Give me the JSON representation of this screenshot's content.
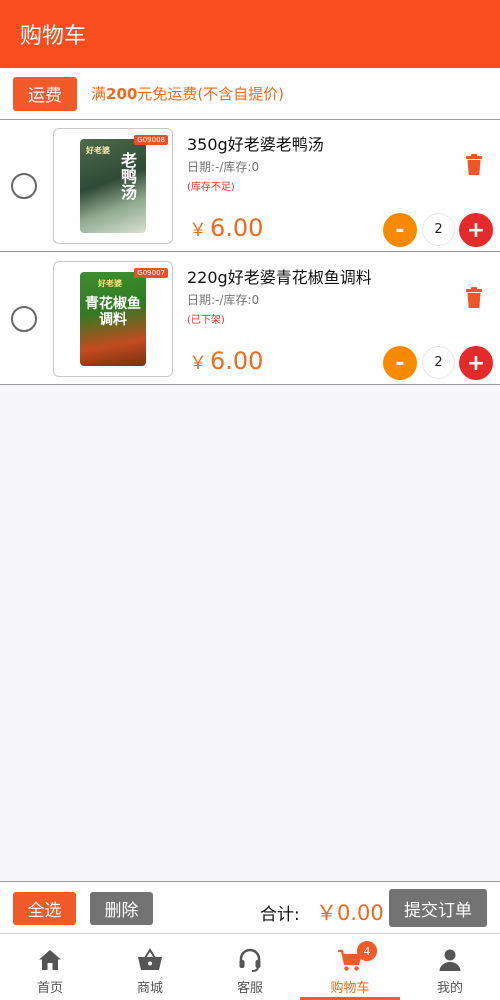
{
  "header": {
    "title": "购物车"
  },
  "shipping": {
    "tag": "运费",
    "prefix": "满",
    "amount": "200",
    "suffix": "元免运费(不含自提价)"
  },
  "items": [
    {
      "sku": "G09008",
      "pack_text": "老鸭汤",
      "brand": "好老婆",
      "name": "350g好老婆老鸭汤",
      "meta": "日期:-/库存:0",
      "status": "(库存不足)",
      "currency": "￥",
      "price": "6.00",
      "qty": "2",
      "minus": "-",
      "plus": "+"
    },
    {
      "sku": "G09007",
      "pack_text": "青花椒鱼调料",
      "brand": "好老婆",
      "name": "220g好老婆青花椒鱼调料",
      "meta": "日期:-/库存:0",
      "status": "(已下架)",
      "currency": "￥",
      "price": "6.00",
      "qty": "2",
      "minus": "-",
      "plus": "+"
    }
  ],
  "footer": {
    "select_all": "全选",
    "delete": "删除",
    "total_label": "合计:",
    "total_value": "￥0.00",
    "submit": "提交订单"
  },
  "tabs": [
    {
      "label": "首页",
      "icon": "home-icon"
    },
    {
      "label": "商城",
      "icon": "basket-icon"
    },
    {
      "label": "客服",
      "icon": "headset-icon"
    },
    {
      "label": "购物车",
      "icon": "cart-icon",
      "badge": "4",
      "active": true
    },
    {
      "label": "我的",
      "icon": "user-icon"
    }
  ],
  "colors": {
    "primary": "#fa4d1f",
    "accent": "#f06a1c",
    "minus": "#f98a00",
    "plus": "#e42a2a",
    "gray_button": "#737373"
  }
}
